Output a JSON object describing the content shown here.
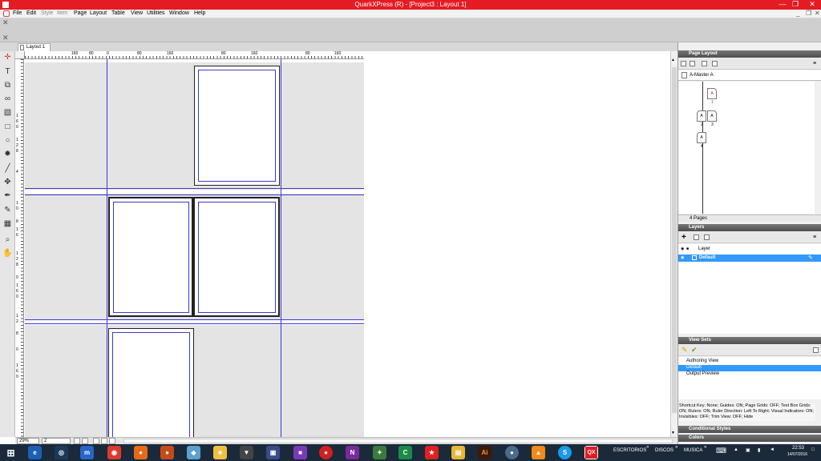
{
  "window": {
    "title": "QuarkXPress (R) - [Project3 : Layout 1]",
    "min": "—",
    "restore": "❐",
    "close": "✕"
  },
  "menu": {
    "items": [
      "File",
      "Edit",
      "Style",
      "Item",
      "Page",
      "Layout",
      "Table",
      "View",
      "Utilities",
      "Window",
      "Help"
    ],
    "disabled": [
      "Style",
      "Item"
    ]
  },
  "tab": {
    "label": "Layout 1"
  },
  "ruler": {
    "h_ticks": [
      "160",
      "80",
      "0",
      "80",
      "160",
      "80",
      "160",
      "80",
      "160"
    ],
    "v_ticks": [
      "1",
      "6",
      "0",
      "1",
      "2",
      "8",
      "4",
      "1",
      "0",
      "8",
      "1",
      "6",
      "1",
      "2",
      "8",
      "0",
      "1",
      "6",
      "0",
      "1",
      "2",
      "8",
      "0",
      "1",
      "6",
      "0"
    ]
  },
  "status": {
    "zoom": "29%",
    "page": "2"
  },
  "page_layout": {
    "title": "Page Layout",
    "master": "A-Master A",
    "pages": [
      {
        "letter": "A",
        "num": "1"
      },
      {
        "letter": "A",
        "num": "2"
      },
      {
        "letter": "A",
        "num": "3"
      },
      {
        "letter": "A",
        "num": "4"
      }
    ],
    "count": "4 Pages"
  },
  "layers": {
    "title": "Layers",
    "header": "Layer",
    "rows": [
      "Default"
    ]
  },
  "view_sets": {
    "title": "View Sets",
    "items": [
      "Authoring View",
      "Default",
      "Output Preview"
    ],
    "selected": 1,
    "description": "Shortcut Key: None; Guides: ON; Page Grids: OFF; Text Box Grids: ON; Rulers: ON; Ruler Direction: Left To Right; Visual Indicators: ON; Invisibles: OFF; Trim View: OFF; Hide"
  },
  "collapsed_palettes": [
    "Conditional Styles",
    "Colors"
  ],
  "taskbar": {
    "labels": [
      "ESCRITORIOS",
      "DISCOS",
      "MUSICA"
    ],
    "time": "22:53",
    "date": "14/07/2016",
    "icons": [
      "windows-start",
      "edge",
      "steam",
      "maxthon",
      "chrome",
      "firefox",
      "firefox-dev",
      "app-blue",
      "folder-app",
      "alien-app",
      "save-app",
      "onenote-purple",
      "record-app",
      "onenote",
      "camtasia",
      "codepen",
      "acrobat",
      "file-explorer",
      "illustrator",
      "java",
      "vlc",
      "skype",
      "nvidia",
      "quarkxpress"
    ]
  },
  "colors": {
    "titlebar": "#e41b23",
    "guide": "#3a3ad0",
    "selection": "#3399ff",
    "palette_header": "#5a5a5a"
  }
}
